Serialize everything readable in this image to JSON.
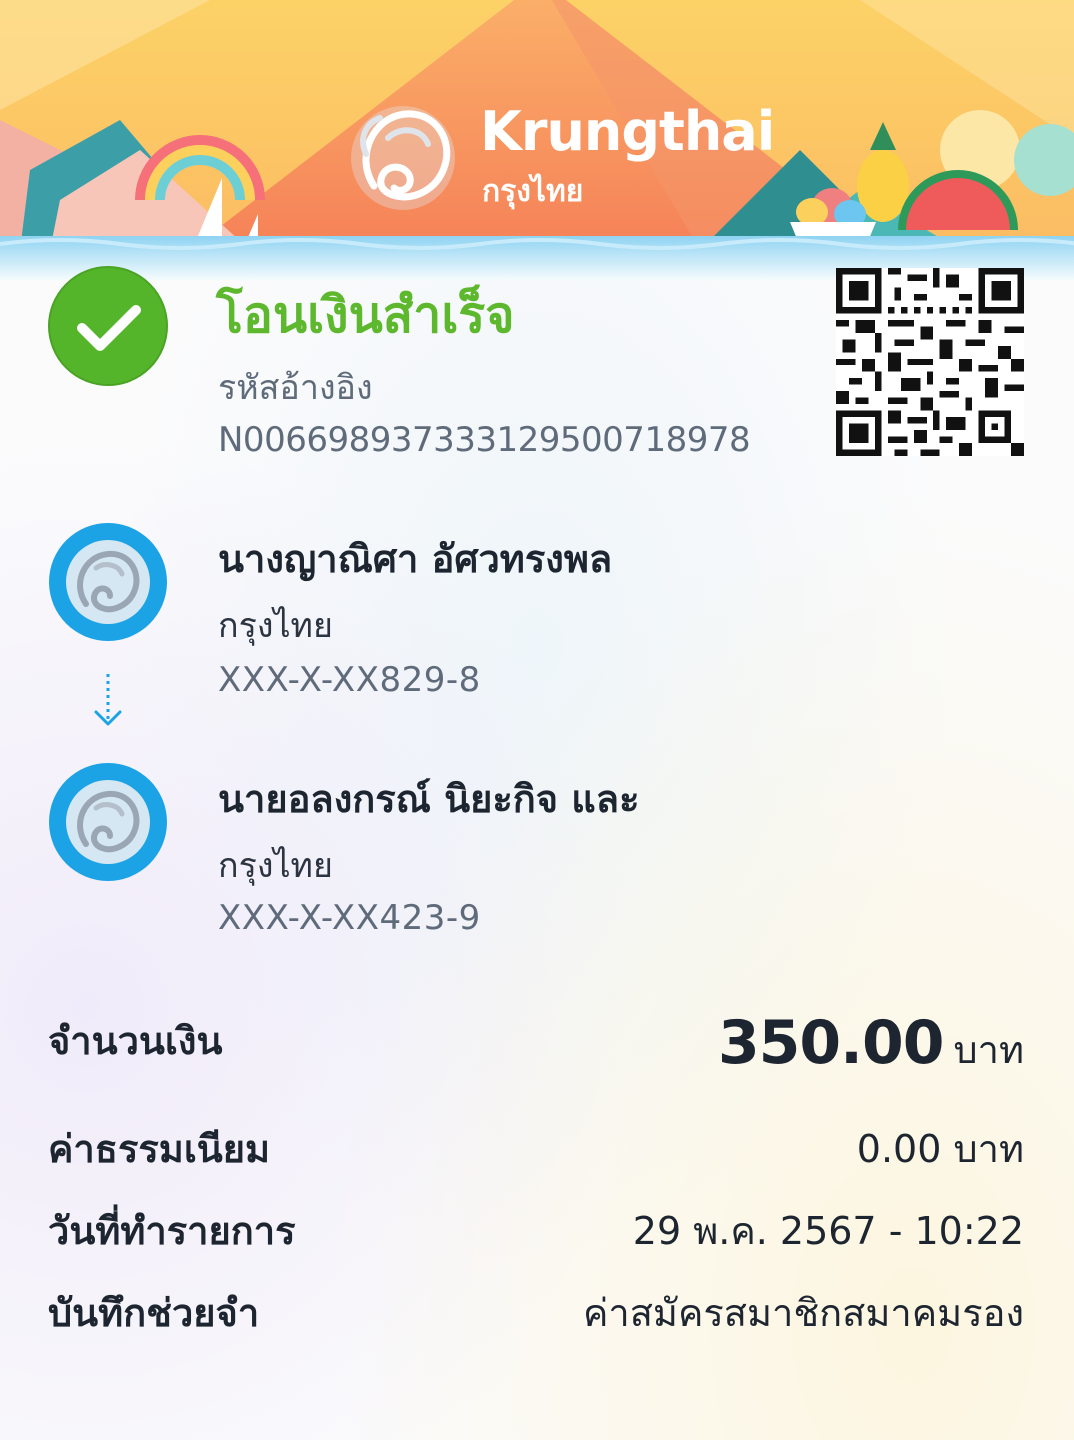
{
  "brand": {
    "name_en": "Krungthai",
    "name_th": "กรุงไทย",
    "logo_icon": "garuda-bird-logo"
  },
  "status": {
    "title": "โอนเงินสำเร็จ",
    "icon": "check-circle-icon",
    "color": "#5db82e"
  },
  "reference": {
    "label": "รหัสอ้างอิง",
    "value": "N006698937333129500718978"
  },
  "qr_icon": "qr-code",
  "sender": {
    "name": "นางญาณิศา อัศวทรงพล",
    "bank": "กรุงไทย",
    "account": "XXX-X-XX829-8"
  },
  "receiver": {
    "name": "นายอลงกรณ์ นิยะกิจ และ",
    "bank": "กรุงไทย",
    "account": "XXX-X-XX423-9"
  },
  "details": {
    "amount_label": "จำนวนเงิน",
    "amount_value": "350.00",
    "amount_unit": "บาท",
    "fee_label": "ค่าธรรมเนียม",
    "fee_value": "0.00 บาท",
    "date_label": "วันที่ทำรายการ",
    "date_value": "29 พ.ค. 2567 - 10:22",
    "memo_label": "บันทึกช่วยจำ",
    "memo_value": "ค่าสมัครสมาชิกสมาคมรอง"
  },
  "colors": {
    "accent_blue": "#1ba3e6",
    "banner_orange": "#f58c5a",
    "banner_yellow": "#fbc35c"
  }
}
